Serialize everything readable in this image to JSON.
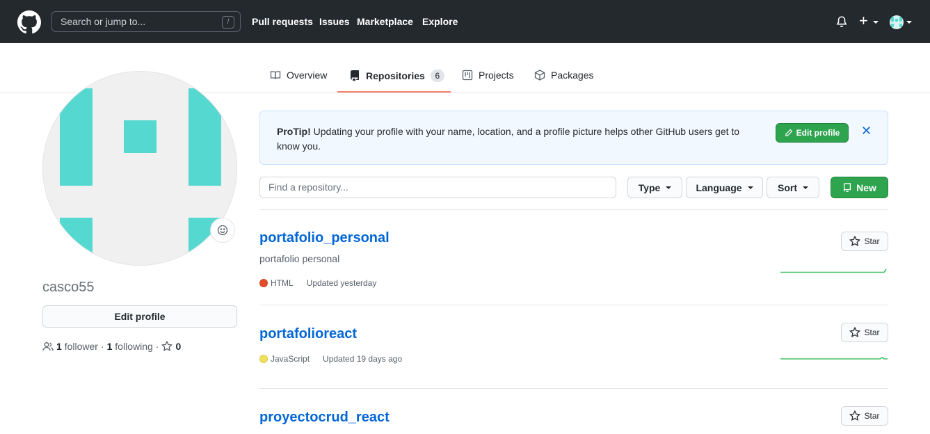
{
  "header": {
    "search_placeholder": "Search or jump to...",
    "slash_key": "/",
    "nav": [
      "Pull requests",
      "Issues",
      "Marketplace",
      "Explore"
    ]
  },
  "tabs": [
    {
      "label": "Overview"
    },
    {
      "label": "Repositories",
      "count": "6",
      "active": true
    },
    {
      "label": "Projects"
    },
    {
      "label": "Packages"
    }
  ],
  "profile": {
    "username": "casco55",
    "edit_label": "Edit profile",
    "followers_count": "1",
    "followers_label": "follower",
    "following_count": "1",
    "following_label": "following",
    "stars_count": "0"
  },
  "protip": {
    "title": "ProTip!",
    "text": "Updating your profile with your name, location, and a profile picture helps other GitHub users get to know you.",
    "button_label": "Edit profile"
  },
  "filters": {
    "find_placeholder": "Find a repository...",
    "type_label": "Type",
    "language_label": "Language",
    "sort_label": "Sort",
    "new_label": "New"
  },
  "repos": [
    {
      "name": "portafolio_personal",
      "description": "portafolio personal",
      "language": "HTML",
      "language_color": "#e34c26",
      "updated": "Updated yesterday",
      "star_label": "Star"
    },
    {
      "name": "portafolioreact",
      "description": "",
      "language": "JavaScript",
      "language_color": "#f1e05a",
      "updated": "Updated 19 days ago",
      "star_label": "Star"
    },
    {
      "name": "proyectocrud_react",
      "description": "",
      "language": "",
      "language_color": "",
      "updated": "",
      "star_label": "Star"
    }
  ],
  "colors": {
    "header_bg": "#24292e",
    "accent_green": "#2ea44f",
    "link_blue": "#0366d6",
    "tab_underline": "#f9826c",
    "avatar_teal": "#55d8cf"
  }
}
